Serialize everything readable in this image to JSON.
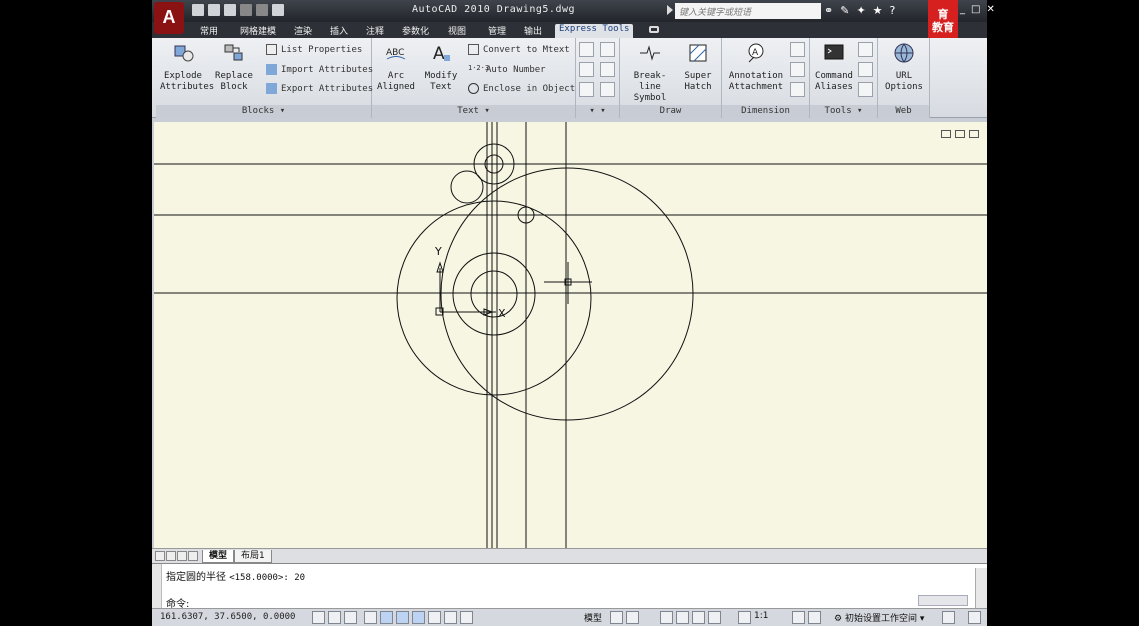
{
  "title_bar": {
    "app_button": "A",
    "title": "AutoCAD 2010  Drawing5.dwg",
    "search_placeholder": "键入关键字或短语",
    "icons": [
      "binoculars-icon",
      "wrench-icon",
      "pin-icon",
      "star-icon",
      "help-icon"
    ],
    "logo_text_line1": "育",
    "logo_text_line2": "教育",
    "window_controls": [
      "_",
      "□",
      "✕"
    ]
  },
  "tabs": [
    {
      "label": "常用"
    },
    {
      "label": "网格建模"
    },
    {
      "label": "渲染"
    },
    {
      "label": "插入"
    },
    {
      "label": "注释"
    },
    {
      "label": "参数化"
    },
    {
      "label": "视图"
    },
    {
      "label": "管理"
    },
    {
      "label": "输出"
    },
    {
      "label": "Express Tools",
      "active": true
    }
  ],
  "ribbon": {
    "blocks": {
      "title": "Blocks",
      "explode_attributes": {
        "line1": "Explode",
        "line2": "Attributes"
      },
      "replace_block": {
        "line1": "Replace",
        "line2": "Block"
      },
      "list_properties": "List Properties",
      "import_attributes": "Import Attributes",
      "export_attributes": "Export Attributes"
    },
    "text": {
      "title": "Text",
      "arc_aligned": {
        "line1": "Arc",
        "line2": "Aligned"
      },
      "modify_text": {
        "line1": "Modify",
        "line2": "Text"
      },
      "convert_to_mtext": "Convert to Mtext",
      "auto_number": "Auto Number",
      "enclose_in_object": "Enclose in Object"
    },
    "draw": {
      "title": "Draw",
      "break_line_symbol": {
        "line1": "Break-line",
        "line2": "Symbol"
      },
      "super_hatch": {
        "line1": "Super",
        "line2": "Hatch"
      }
    },
    "dimension": {
      "title": "Dimension",
      "annotation_attachment": {
        "line1": "Annotation",
        "line2": "Attachment"
      }
    },
    "tools": {
      "title": "Tools",
      "command_aliases": {
        "line1": "Command",
        "line2": "Aliases"
      }
    },
    "web": {
      "title": "Web",
      "url_options": {
        "line1": "URL",
        "line2": "Options"
      }
    }
  },
  "layout_tabs": [
    {
      "label": "模型",
      "active": true
    },
    {
      "label": "布局1"
    }
  ],
  "command_line": {
    "history_prompt": "指定圆的半径",
    "history_value": "<158.0000>: 20",
    "current_prompt": "命令:"
  },
  "status_bar": {
    "coordinates": "161.6307, 37.6500, 0.0000",
    "model_label": "模型",
    "annotation_scale": "1:1",
    "workspace": "初始设置工作空间"
  },
  "ucs": {
    "x_label": "X",
    "y_label": "Y"
  }
}
